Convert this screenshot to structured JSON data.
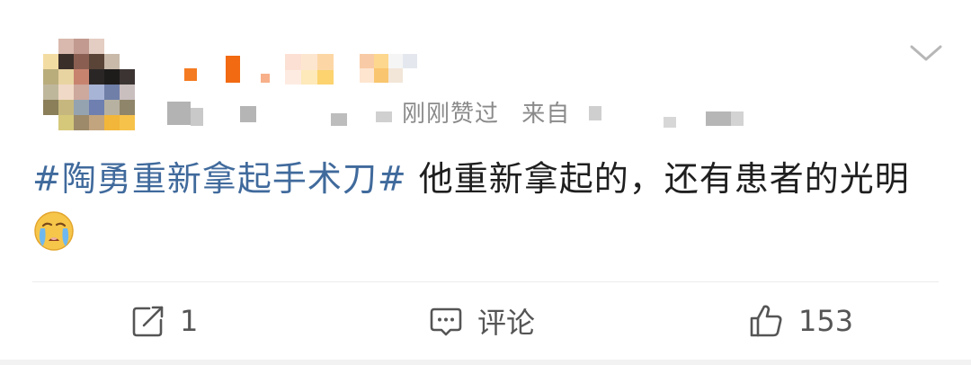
{
  "post": {
    "time": "刚刚赞过",
    "source_prefix": "来自",
    "topic": "#陶勇重新拿起手术刀#",
    "text": " 他重新拿起的，还有患者的光明",
    "emoji": "crying-face-emoji"
  },
  "actions": {
    "repost_count": "1",
    "comment_label": "评论",
    "like_count": "153"
  },
  "icons": {
    "more": "chevron-down-icon",
    "repost": "repost-icon",
    "comment": "comment-icon",
    "like": "thumbs-up-icon"
  },
  "colors": {
    "topic": "#406a9c",
    "text": "#1f1f1f",
    "meta": "#8a8a8a",
    "icon": "#555555"
  }
}
